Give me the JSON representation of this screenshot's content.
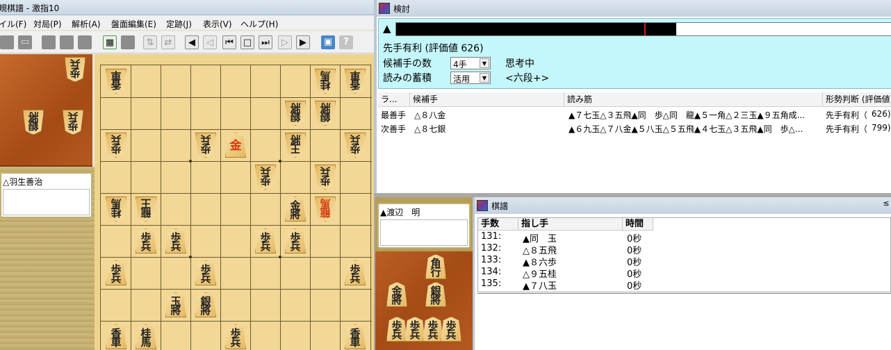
{
  "main": {
    "title": "規棋譜 - 激指10",
    "menus": [
      "イル(F)",
      "対局(P)",
      "解析(A)",
      "盤面編集(E)",
      "定跡(J)",
      "表示(V)",
      "ヘルプ(H)"
    ],
    "gote_player": "△羽生善治",
    "sente_player": "▲渡辺　明"
  },
  "analysis": {
    "title": "検討",
    "eval_arrow": "▲",
    "eval_fill_percent": 56.5,
    "status": "先手有利 (評価値 626)",
    "candidates_label": "候補手の数",
    "candidates_value": "4手",
    "accumulate_label": "読みの蓄積",
    "accumulate_value": "活用",
    "thinking": "思考中",
    "level": "<六段+>",
    "columns": [
      "ラ...",
      "候補手",
      "読み筋",
      "形勢判断 (評価値)"
    ],
    "rows": [
      {
        "rank": "最善手",
        "move": "△８八金",
        "pv": "▲７七玉△３五飛▲同　歩△同　龍▲５一角△２三玉▲９五角成...",
        "judge": "先手有利（",
        "score": "626)"
      },
      {
        "rank": "次善手",
        "move": "△８七銀",
        "pv": "▲６九玉△７八金▲５八玉△５五飛▲４七玉△３五飛▲同　歩△...",
        "judge": "先手有利（",
        "score": "799)"
      }
    ]
  },
  "kifu": {
    "title": "棋譜",
    "close": "≤",
    "columns": [
      "手数",
      "指し手",
      "時間"
    ],
    "rows": [
      {
        "num": "131:",
        "move": "▲同　玉",
        "time": "0秒"
      },
      {
        "num": "132:",
        "move": "△８五飛",
        "time": "0秒"
      },
      {
        "num": "133:",
        "move": "▲８六歩",
        "time": "0秒"
      },
      {
        "num": "134:",
        "move": "△９五桂",
        "time": "0秒"
      },
      {
        "num": "135:",
        "move": "▲７八玉",
        "time": "0秒"
      }
    ]
  }
}
